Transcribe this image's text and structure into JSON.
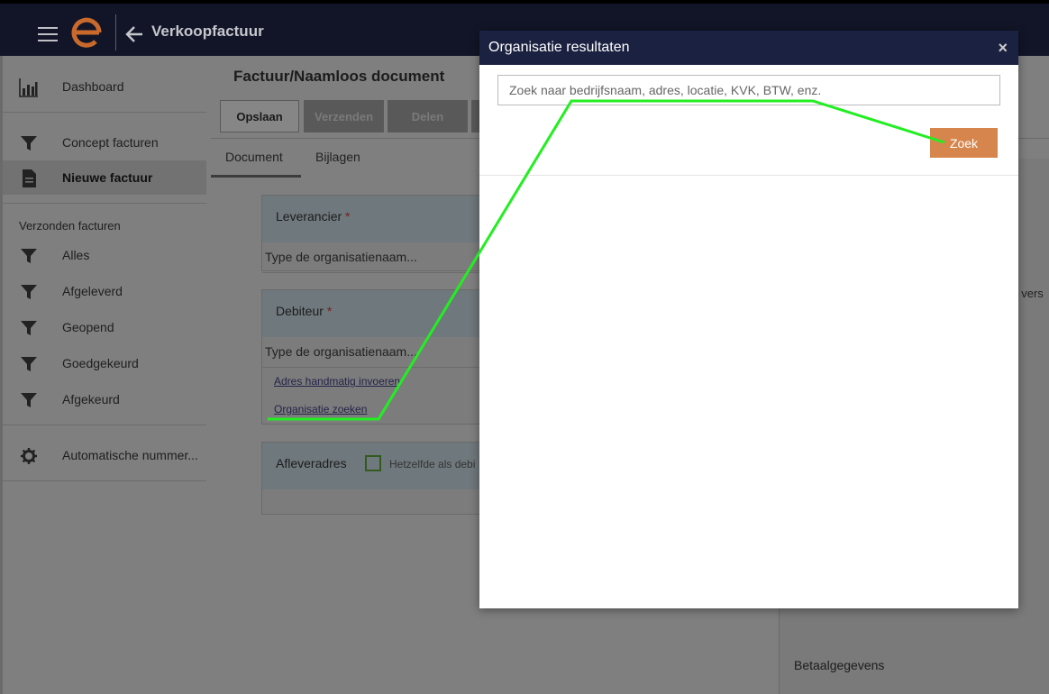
{
  "app": {
    "title": "Verkoopfactuur"
  },
  "sidebar": {
    "items": [
      {
        "label": "Dashboard",
        "icon": "bar-chart-icon"
      },
      {
        "label": "Concept facturen",
        "icon": "filter-icon"
      },
      {
        "label": "Nieuwe factuur",
        "icon": "document-icon"
      },
      {
        "label": "Alles",
        "icon": "filter-icon"
      },
      {
        "label": "Afgeleverd",
        "icon": "filter-icon"
      },
      {
        "label": "Geopend",
        "icon": "filter-icon"
      },
      {
        "label": "Goedgekeurd",
        "icon": "filter-icon"
      },
      {
        "label": "Afgekeurd",
        "icon": "filter-icon"
      },
      {
        "label": "Automatische nummer...",
        "icon": "gear-icon"
      }
    ],
    "section_label": "Verzonden facturen"
  },
  "main": {
    "doc_title": "Factuur/Naamloos document",
    "toolbar": {
      "save": "Opslaan",
      "send": "Verzenden",
      "share": "Delen"
    },
    "tabs": [
      "Document",
      "Bijlagen"
    ],
    "supplier": {
      "label": "Leverancier",
      "required": "*",
      "placeholder": "Type de organisatienaam..."
    },
    "debtor": {
      "label": "Debiteur",
      "required": "*",
      "placeholder": "Type de organisatienaam...",
      "link_manual": "Adres handmatig invoeren",
      "link_search": "Organisatie zoeken"
    },
    "delivery": {
      "label": "Afleveradres",
      "checkbox_label": "Hetzelfde als debi"
    },
    "right_panel": {
      "payment_label": "Betaalgegevens",
      "peek_text": "t vers"
    }
  },
  "modal": {
    "title": "Organisatie resultaten",
    "close": "×",
    "search_placeholder": "Zoek naar bedrijfsnaam, adres, locatie, KVK, BTW, enz.",
    "search_button": "Zoek"
  },
  "colors": {
    "accent": "#d6864c",
    "header": "#1b2140",
    "annotation": "#22ee22"
  }
}
